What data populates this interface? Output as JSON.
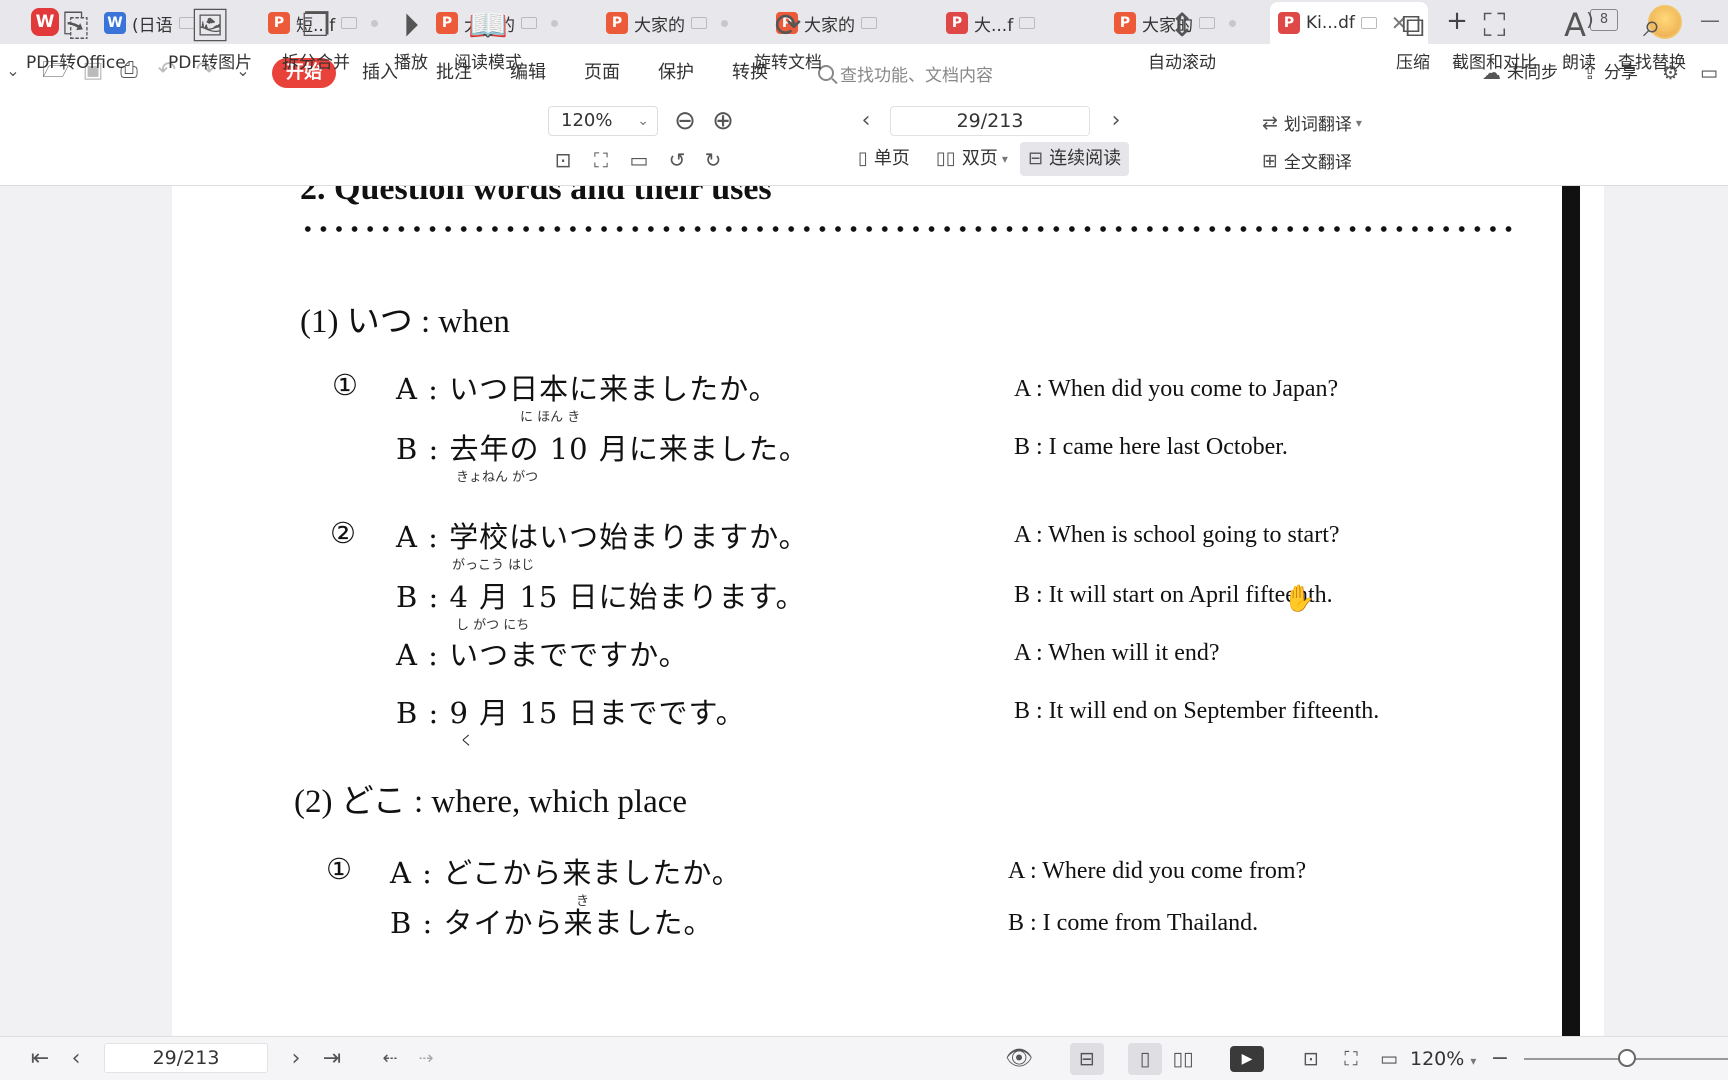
{
  "tabs": [
    {
      "label": "(日语",
      "type": "word"
    },
    {
      "label": "短...f",
      "type": "pdf"
    },
    {
      "label": "大家的",
      "type": "pdf"
    },
    {
      "label": "大家的",
      "type": "pdf"
    },
    {
      "label": "大家的",
      "type": "pdf"
    },
    {
      "label": "大...f",
      "type": "pdf"
    },
    {
      "label": "大家的",
      "type": "pdf"
    },
    {
      "label": "Ki...df",
      "type": "pdf",
      "active": true
    }
  ],
  "window_count": "8",
  "menu": {
    "items": [
      "开始",
      "插入",
      "批注",
      "编辑",
      "页面",
      "保护",
      "转换"
    ],
    "active": "开始",
    "search_placeholder": "查找功能、文档内容",
    "sync_label": "未同步",
    "share_label": "分享"
  },
  "toolbar": {
    "pdf_to_office": "PDF转Office",
    "pdf_to_image": "PDF转图片",
    "split_merge": "拆分合并",
    "play": "播放",
    "read_mode": "阅读模式",
    "zoom_value": "120%",
    "rotate_doc": "旋转文档",
    "page_indicator": "29/213",
    "single_page": "单页",
    "double_page": "双页",
    "continuous": "连续阅读",
    "auto_scroll": "自动滚动",
    "word_translate": "划词翻译",
    "full_translate": "全文翻译",
    "compress": "压缩",
    "screenshot_compare": "截图和对比",
    "read_aloud": "朗读",
    "find_replace": "查找替换"
  },
  "document": {
    "heading": "2.   Question words and their uses",
    "sections": [
      {
        "title": "(1)   いつ : when",
        "dialogs": [
          {
            "num": "①",
            "lines": [
              {
                "jp": "A : いつ日本に来ましたか。",
                "furigana": "に ほん        き",
                "en": "A : When did you come to Japan?"
              },
              {
                "jp": "B : 去年の 10 月に来ました。",
                "furigana": "きょねん           がつ",
                "en": "B : I came here last October."
              }
            ]
          },
          {
            "num": "②",
            "lines": [
              {
                "jp": "A : 学校はいつ始まりますか。",
                "furigana": "がっこう             はじ",
                "en": "A : When is school going to start?"
              },
              {
                "jp": "B : 4 月 15 日に始まります。",
                "furigana": "し がつ        にち",
                "en": "B : It will start on April fifteenth."
              },
              {
                "jp": "A : いつまでですか。",
                "furigana": "",
                "en": "A : When will it end?"
              },
              {
                "jp": "B : 9 月 15 日までです。",
                "furigana": "く",
                "en": "B : It will end on September fifteenth."
              }
            ]
          }
        ]
      },
      {
        "title": "(2)   どこ : where, which place",
        "dialogs": [
          {
            "num": "①",
            "lines": [
              {
                "jp": "A : どこから来ましたか。",
                "furigana": "",
                "en": "A : Where did you come from?"
              },
              {
                "jp": "B : タイから来ました。",
                "furigana": "き",
                "en": "B : I come from Thailand."
              }
            ]
          }
        ]
      }
    ]
  },
  "statusbar": {
    "page": "29/213",
    "zoom": "120%"
  },
  "colors": {
    "accent": "#e9423b",
    "pdf_icon": "#ec5a3a",
    "word_icon": "#3b74d8"
  }
}
